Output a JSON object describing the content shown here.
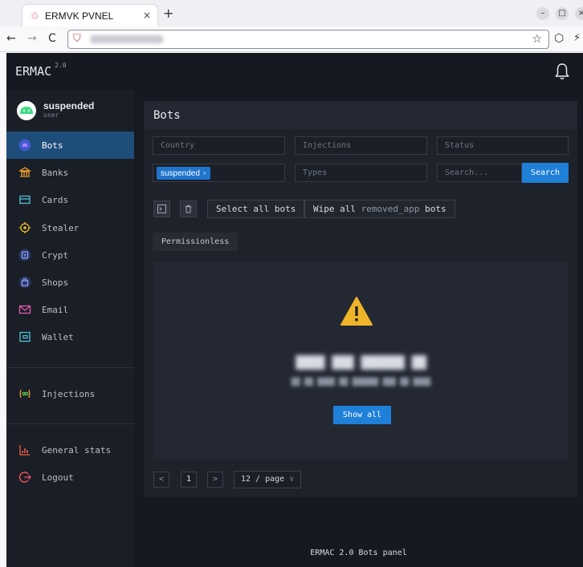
{
  "browser": {
    "tab_title": "ERMVK PVNEL",
    "tab_close": "×",
    "new_tab": "+",
    "back": "←",
    "forward": "→",
    "reload": "C",
    "star": "☆",
    "shield": "⬡",
    "extension": "⚡",
    "menu": "≡",
    "win_min": "–",
    "win_max": "□",
    "win_close": "×"
  },
  "app": {
    "logo": "ERMAC",
    "version": "2.0"
  },
  "profile": {
    "name": "suspended",
    "role": "user"
  },
  "sidebar": {
    "items": [
      {
        "label": "Bots",
        "icon": "android-icon",
        "active": true
      },
      {
        "label": "Banks",
        "icon": "bank-icon"
      },
      {
        "label": "Cards",
        "icon": "card-icon"
      },
      {
        "label": "Stealer",
        "icon": "target-icon"
      },
      {
        "label": "Crypt",
        "icon": "crypto-wallet-icon"
      },
      {
        "label": "Shops",
        "icon": "shopping-bag-icon"
      },
      {
        "label": "Email",
        "icon": "mail-icon"
      },
      {
        "label": "Wallet",
        "icon": "wallet-icon"
      }
    ],
    "injections": {
      "label": "Injections",
      "icon": "injection-icon"
    },
    "stats": {
      "label": "General stats",
      "icon": "chart-icon"
    },
    "logout": {
      "label": "Logout",
      "icon": "logout-icon"
    }
  },
  "main": {
    "title": "Bots",
    "filters": {
      "country_placeholder": "Country",
      "injections_placeholder": "Injections",
      "status_placeholder": "Status",
      "tag": "suspended",
      "tag_remove": "×",
      "types_placeholder": "Types",
      "search_placeholder": "Search...",
      "search_button": "Search"
    },
    "actions": {
      "select_all": "Select all bots",
      "wipe_prefix": "Wipe all",
      "wipe_mid": "removed_app",
      "wipe_suffix": "bots"
    },
    "permission_tag": "Permissionless",
    "empty": {
      "show_all": "Show all"
    },
    "pagination": {
      "prev": "<",
      "current": "1",
      "next": ">",
      "page_size": "12 / page",
      "dropdown": "∨"
    }
  },
  "footer": "ERMAC 2.0 Bots panel",
  "colors": {
    "accent": "#1f80d8",
    "active_menu": "#1f4d7a",
    "warning": "#f0b429",
    "background": "#151921"
  }
}
